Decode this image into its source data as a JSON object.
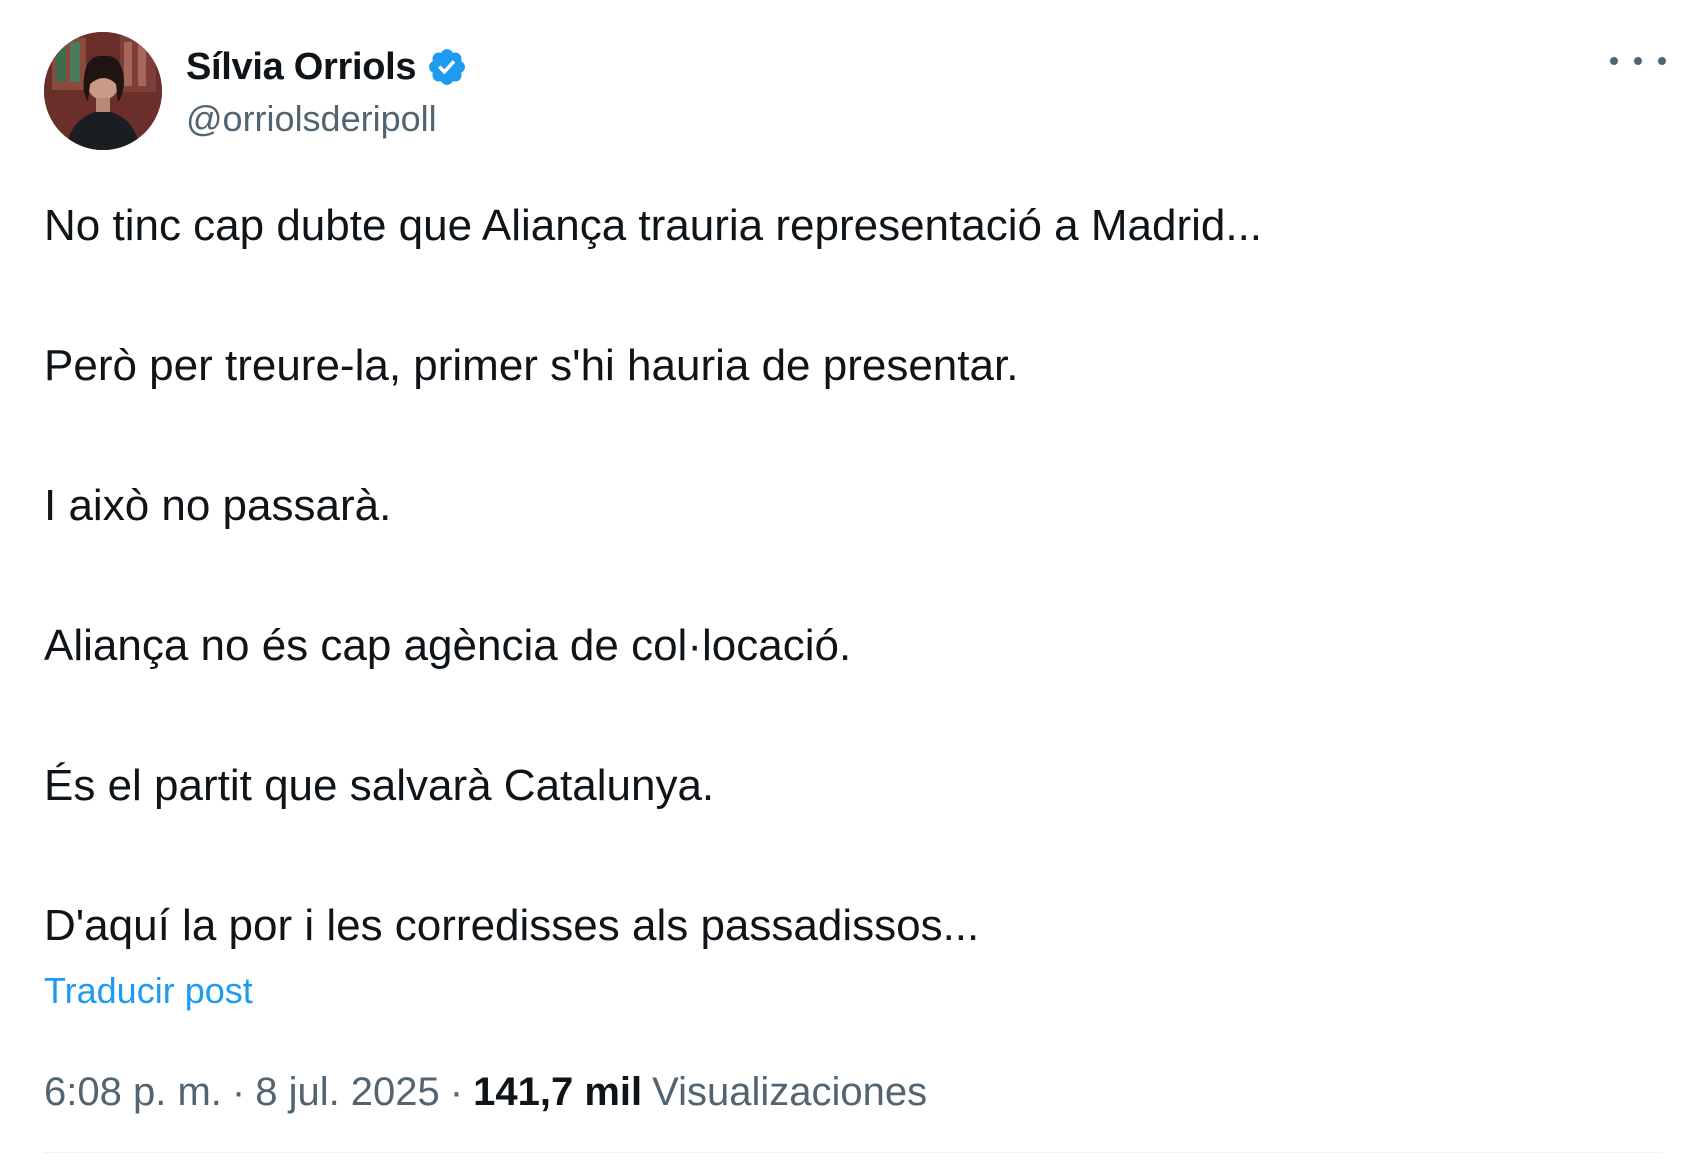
{
  "author": {
    "display_name": "Sílvia Orriols",
    "handle": "@orriolsderipoll",
    "verified": true,
    "verified_badge_color": "#1d9bf0"
  },
  "menu_icon": "more-horizontal-icon",
  "post": {
    "paragraphs": [
      "No tinc cap dubte que Aliança trauria representació a Madrid...",
      "Però per treure-la, primer s'hi hauria de presentar.",
      "I això no passarà.",
      "Aliança no és cap agència de col·locació.",
      "És el partit que salvarà Catalunya.",
      "D'aquí la por i les corredisses als passadissos..."
    ],
    "translate_label": "Traducir post"
  },
  "meta": {
    "time": "6:08 p. m.",
    "separator": "·",
    "date": "8 jul. 2025",
    "views_count": "141,7 mil",
    "views_label": "Visualizaciones"
  },
  "colors": {
    "text": "#0f1419",
    "secondary": "#536471",
    "link": "#1d9bf0"
  }
}
